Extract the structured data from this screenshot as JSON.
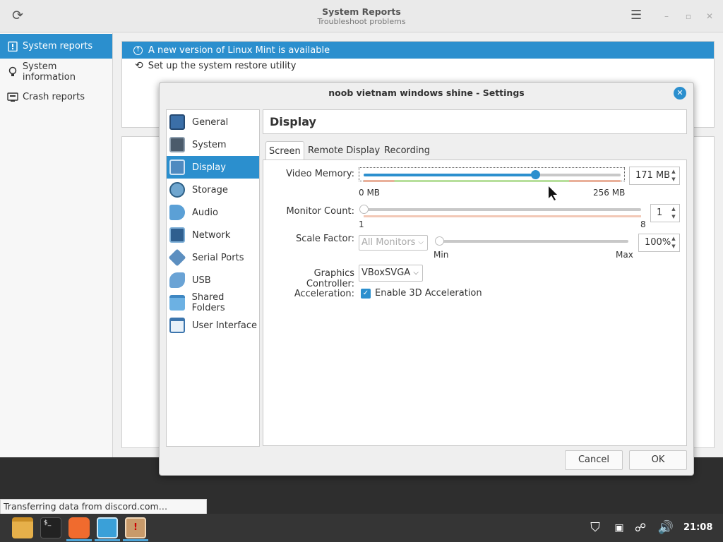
{
  "window": {
    "title": "System Reports",
    "subtitle": "Troubleshoot problems"
  },
  "sidebar": {
    "items": [
      {
        "label": "System reports",
        "icon": "report-icon",
        "active": true
      },
      {
        "label": "System information",
        "icon": "lightbulb-icon",
        "active": false
      },
      {
        "label": "Crash reports",
        "icon": "crash-icon",
        "active": false
      }
    ]
  },
  "main": {
    "banner_text": "A new version of Linux Mint is available",
    "restore_text": "Set up the system restore utility"
  },
  "dialog": {
    "title": "noob vietnam windows shine - Settings",
    "categories": [
      "General",
      "System",
      "Display",
      "Storage",
      "Audio",
      "Network",
      "Serial Ports",
      "USB",
      "Shared Folders",
      "User Interface"
    ],
    "active_category": "Display",
    "page_title": "Display",
    "tabs": [
      "Screen",
      "Remote Display",
      "Recording"
    ],
    "active_tab": "Screen",
    "video_memory": {
      "label": "Video Memory:",
      "value": "171 MB",
      "min_label": "0 MB",
      "max_label": "256 MB",
      "level": 0.668
    },
    "monitor_count": {
      "label": "Monitor Count:",
      "value": "1",
      "min_label": "1",
      "max_label": "8",
      "level": 0.0
    },
    "scale_factor": {
      "label": "Scale Factor:",
      "combo": "All Monitors",
      "value": "100%",
      "min_label": "Min",
      "max_label": "Max",
      "level": 0.0
    },
    "graphics_controller": {
      "label": "Graphics Controller:",
      "value": "VBoxSVGA"
    },
    "acceleration": {
      "label": "Acceleration:",
      "checkbox_label": "Enable 3D Acceleration",
      "checked": true
    },
    "buttons": {
      "cancel": "Cancel",
      "ok": "OK"
    }
  },
  "tooltip": "Transferring data from discord.com…",
  "taskbar": {
    "clock": "21:08"
  },
  "colors": {
    "accent": "#2b8fce",
    "panel": "#353535"
  }
}
